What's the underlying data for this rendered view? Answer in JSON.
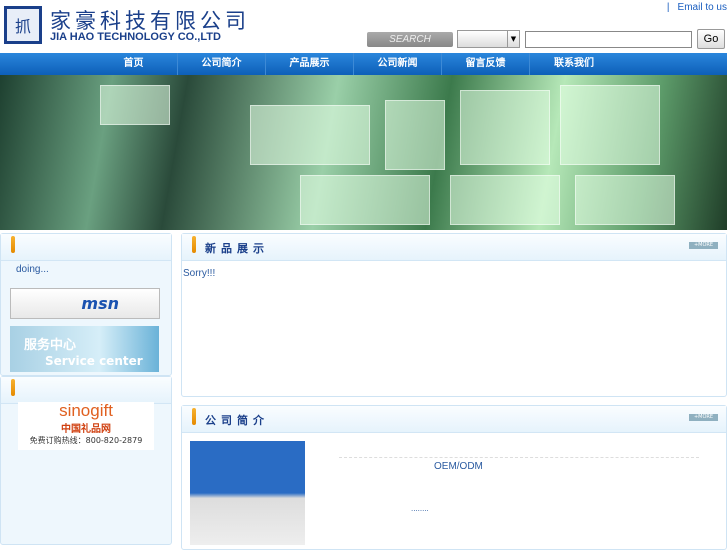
{
  "header": {
    "logo_char": "抓",
    "company_cn": "家豪科技有限公司",
    "company_en": "JIA HAO TECHNOLOGY CO.,LTD",
    "email_sep": "|",
    "email_link": "Email to us"
  },
  "search": {
    "label": "SEARCH",
    "select_value": "",
    "input_value": "",
    "go": "Go"
  },
  "nav": [
    "首页",
    "公司简介",
    "产品展示",
    "公司新闻",
    "留言反馈",
    "联系我们"
  ],
  "left": {
    "status": "doing...",
    "msn": "msn",
    "service_cn": "服务中心",
    "service_en": "Service center",
    "sino_logo": "sinogift",
    "sino_cn": "中国礼品网",
    "sino_hotline": "免费订购热线：800-820-2879"
  },
  "products": {
    "title": "新品展示",
    "more": "+MORE",
    "content": "Sorry!!!"
  },
  "about": {
    "title": "公司简介",
    "more": "+MORE",
    "oem": "OEM/ODM",
    "dots": "........"
  }
}
